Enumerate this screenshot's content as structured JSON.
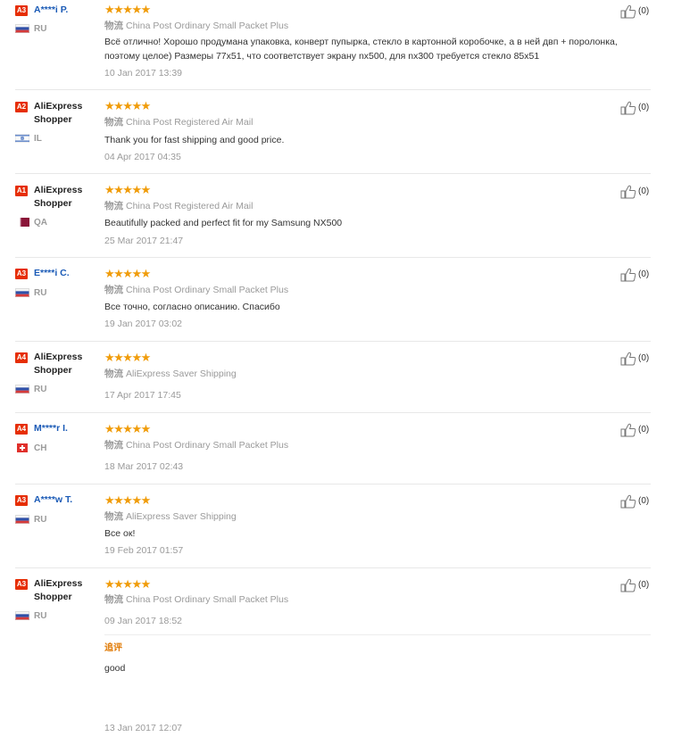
{
  "colors": {
    "badge": "#e62e04",
    "star": "#f09c0a",
    "link": "#1a5ab6",
    "muted": "#9a9a9a",
    "additional": "#e07a05"
  },
  "shipping_label": "物流",
  "reviews": [
    {
      "level": "A3",
      "user": "A****i P.",
      "country": "RU",
      "flag": "ru-flag-icon",
      "stars": "★★★★★",
      "shipping": "China Post Ordinary Small Packet Plus",
      "text": "Всё отлично! Хорошо продумана упаковка, конверт пупырка, стекло в картонной коробочке, а в ней двп + поролонка, поэтому целое) Размеры 77х51, что соответствует экрану nx500, для nx300 требуется стекло 85х51",
      "date": "10 Jan 2017 13:39",
      "helpful": "(0)"
    },
    {
      "level": "A2",
      "user": "AliExpress Shopper",
      "country": "IL",
      "flag": "il-flag-icon",
      "stars": "★★★★★",
      "shipping": "China Post Registered Air Mail",
      "text": "Thank you for fast shipping and good price.",
      "date": "04 Apr 2017 04:35",
      "helpful": "(0)"
    },
    {
      "level": "A1",
      "user": "AliExpress Shopper",
      "country": "QA",
      "flag": "qa-flag-icon",
      "stars": "★★★★★",
      "shipping": "China Post Registered Air Mail",
      "text": "Beautifully packed and perfect fit for my Samsung NX500",
      "date": "25 Mar 2017 21:47",
      "helpful": "(0)"
    },
    {
      "level": "A3",
      "user": "E****i C.",
      "country": "RU",
      "flag": "ru-flag-icon",
      "stars": "★★★★★",
      "shipping": "China Post Ordinary Small Packet Plus",
      "text": "Все точно, согласно описанию. Спасибо",
      "date": "19 Jan 2017 03:02",
      "helpful": "(0)"
    },
    {
      "level": "A4",
      "user": "AliExpress Shopper",
      "country": "RU",
      "flag": "ru-flag-icon",
      "stars": "★★★★★",
      "shipping": "AliExpress Saver Shipping",
      "text": "",
      "date": "17 Apr 2017 17:45",
      "helpful": "(0)"
    },
    {
      "level": "A4",
      "user": "M****r I.",
      "country": "CH",
      "flag": "ch-flag-icon",
      "stars": "★★★★★",
      "shipping": "China Post Ordinary Small Packet Plus",
      "text": "",
      "date": "18 Mar 2017 02:43",
      "helpful": "(0)"
    },
    {
      "level": "A3",
      "user": "A****w T.",
      "country": "RU",
      "flag": "ru-flag-icon",
      "stars": "★★★★★",
      "shipping": "AliExpress Saver Shipping",
      "text": "Все ок!",
      "date": "19 Feb 2017 01:57",
      "helpful": "(0)"
    },
    {
      "level": "A3",
      "user": "AliExpress Shopper",
      "country": "RU",
      "flag": "ru-flag-icon",
      "stars": "★★★★★",
      "shipping": "China Post Ordinary Small Packet Plus",
      "text": "",
      "date": "09 Jan 2017 18:52",
      "helpful": "(0)",
      "additional": {
        "label": "追评",
        "text": "good",
        "date": "13 Jan 2017 12:07"
      }
    }
  ]
}
